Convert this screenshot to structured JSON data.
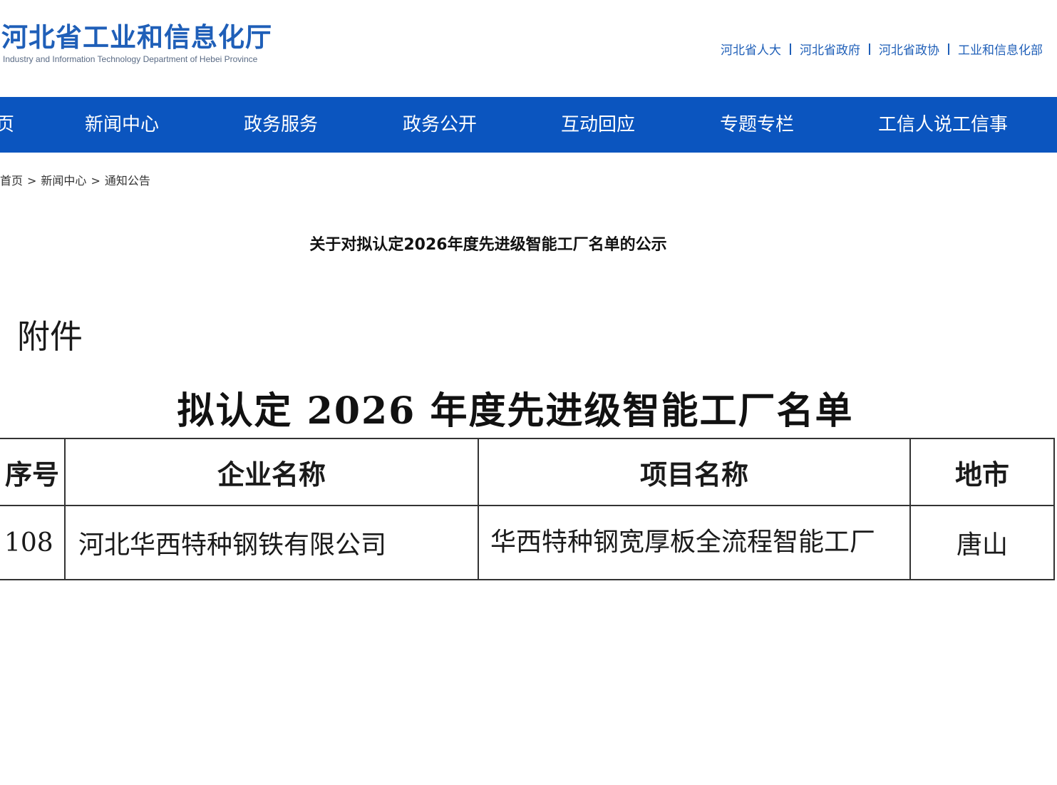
{
  "header": {
    "logo_cn": "河北省工业和信息化厅",
    "logo_en": "Industry and Information Technology Department of Hebei Province",
    "links": [
      "河北省人大",
      "河北省政府",
      "河北省政协",
      "工业和信息化部"
    ]
  },
  "nav": {
    "items": [
      "页",
      "新闻中心",
      "政务服务",
      "政务公开",
      "互动回应",
      "专题专栏",
      "工信人说工信事"
    ]
  },
  "breadcrumb": {
    "items": [
      "首页",
      "新闻中心",
      "通知公告"
    ],
    "separator": ">"
  },
  "article": {
    "title": "关于对拟认定2026年度先进级智能工厂名单的公示"
  },
  "attachment": {
    "label": "附件",
    "list_title": "拟认定 2026 年度先进级智能工厂名单",
    "columns": [
      "序号",
      "企业名称",
      "项目名称",
      "地市"
    ],
    "rows": [
      {
        "seq": "108",
        "enterprise": "河北华西特种钢铁有限公司",
        "project": "华西特种钢宽厚板全流程智能工厂",
        "city": "唐山"
      }
    ]
  },
  "colors": {
    "brand_blue": "#0b55bf",
    "link_blue": "#1f5fb8"
  }
}
